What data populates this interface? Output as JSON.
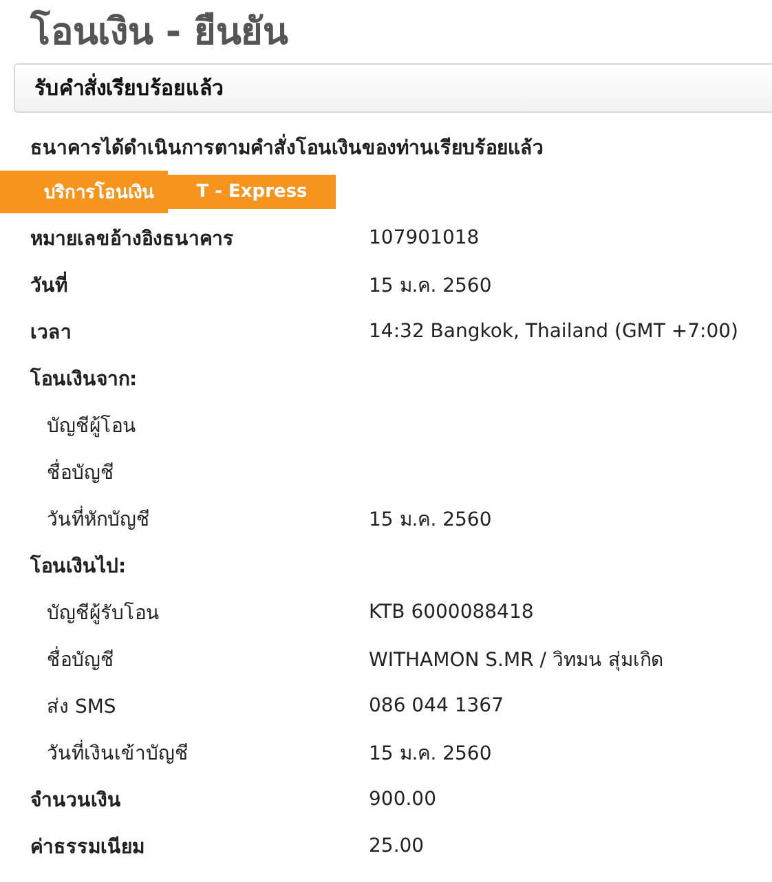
{
  "title": "โอนเงิน - ยืนยัน",
  "banner": "รับคำสั่งเรียบร้อยแล้ว",
  "message": "ธนาคารได้ดำเนินการตามคำสั่งโอนเงินของท่านเรียบร้อยแล้ว",
  "rows": [
    {
      "kind": "badge",
      "label": "บริการโอนเงิน",
      "value": "T - Express"
    },
    {
      "kind": "field",
      "label": "หมายเลขอ้างอิงธนาคาร",
      "value": "107901018"
    },
    {
      "kind": "field",
      "label": "วันที่",
      "value": "15 ม.ค. 2560"
    },
    {
      "kind": "field",
      "label": "เวลา",
      "value": "14:32 Bangkok, Thailand (GMT +7:00)"
    },
    {
      "kind": "section",
      "label": "โอนเงินจาก:"
    },
    {
      "kind": "sub",
      "label": "บัญชีผู้โอน"
    },
    {
      "kind": "sub",
      "label": "ชื่อบัญชี"
    },
    {
      "kind": "sub",
      "label": "วันที่หักบัญชี",
      "value": "15 ม.ค. 2560"
    },
    {
      "kind": "section",
      "label": "โอนเงินไป:"
    },
    {
      "kind": "sub",
      "label": "บัญชีผู้รับโอน",
      "value": "KTB 6000088418"
    },
    {
      "kind": "sub",
      "label": "ชื่อบัญชี",
      "value": "WITHAMON S.MR / วิทมน สุ่มเกิด"
    },
    {
      "kind": "sub",
      "label": "ส่ง SMS",
      "value": "086 044 1367"
    },
    {
      "kind": "sub",
      "label": "วันที่เงินเข้าบัญชี",
      "value": "15 ม.ค. 2560"
    },
    {
      "kind": "field",
      "label": "จำนวนเงิน",
      "value": "900.00"
    },
    {
      "kind": "field",
      "label": "ค่าธรรมเนียม",
      "value": "25.00"
    }
  ]
}
